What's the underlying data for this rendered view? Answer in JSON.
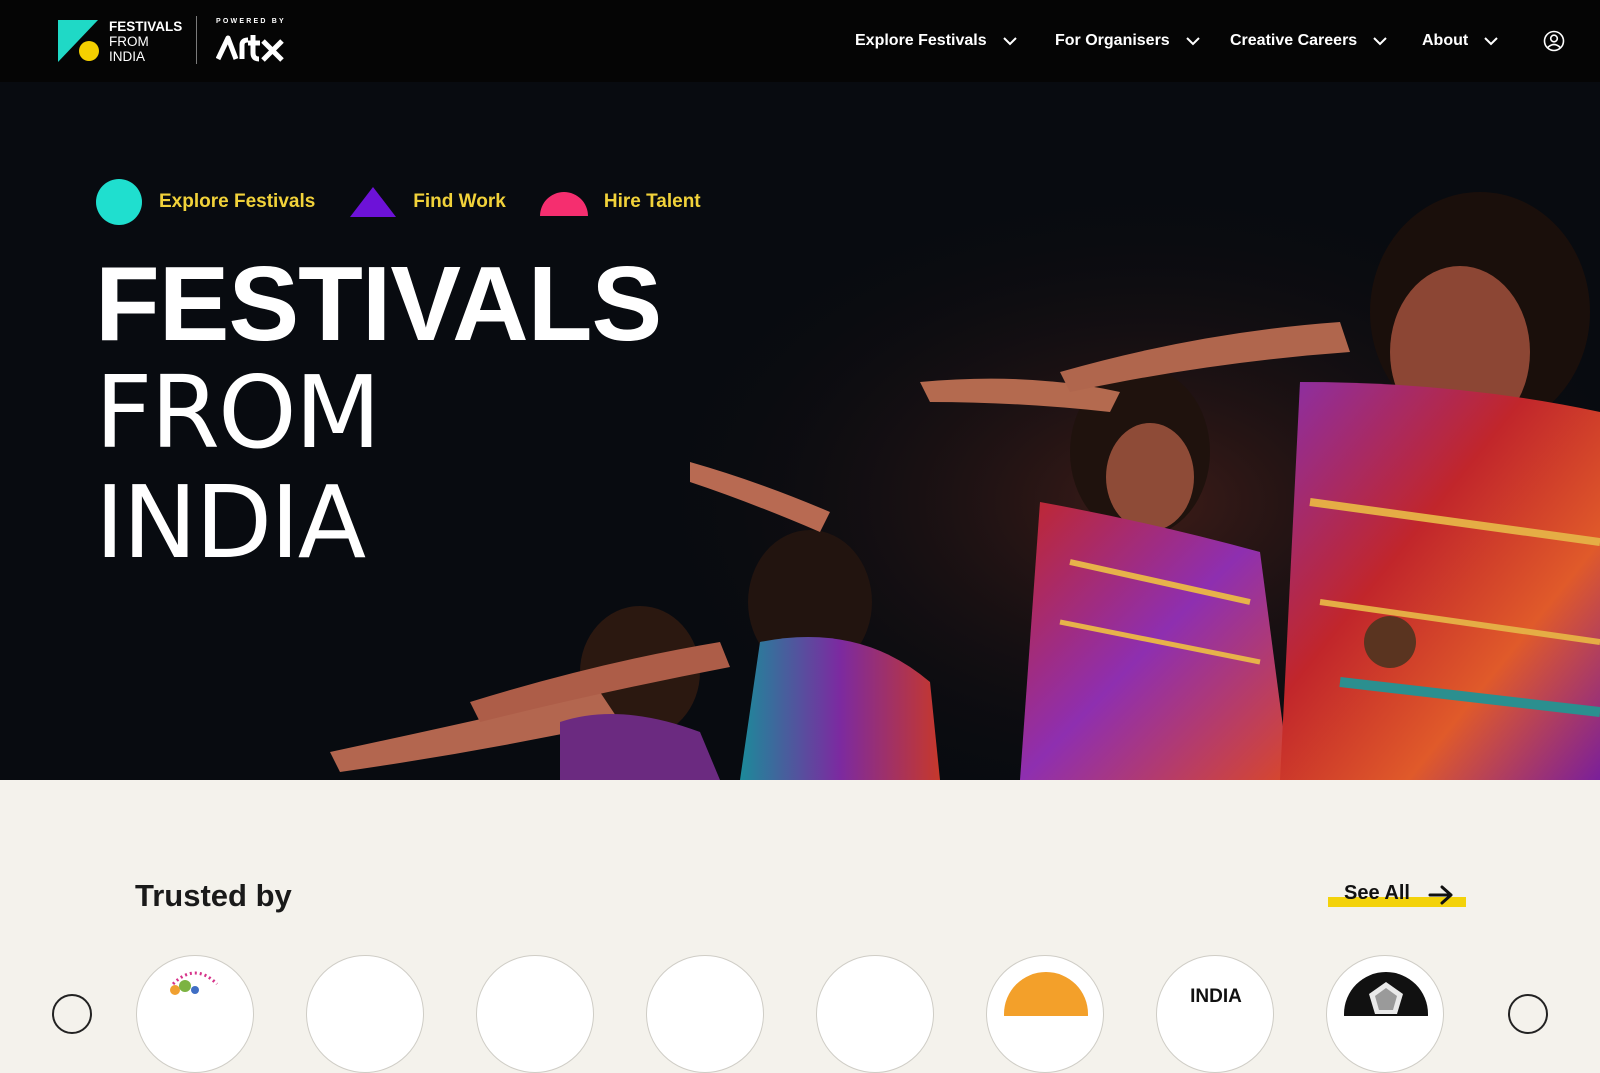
{
  "header": {
    "logo": {
      "line1": "FESTIVALS",
      "line2": "FROM",
      "line3": "INDIA",
      "powered_by": "POWERED BY",
      "partner": "artx"
    },
    "nav": [
      {
        "label": "Explore Festivals"
      },
      {
        "label": "For Organisers"
      },
      {
        "label": "Creative Careers"
      },
      {
        "label": "About"
      }
    ],
    "user_icon": "user-circle-icon"
  },
  "hero": {
    "quick_links": [
      {
        "label": "Explore Festivals",
        "icon": "circle",
        "color": "#1fdfcf"
      },
      {
        "label": "Find Work",
        "icon": "triangle",
        "color": "#6d12d8"
      },
      {
        "label": "Hire Talent",
        "icon": "semicircle",
        "color": "#f52e6f"
      }
    ],
    "title_line1": "FESTIVALS",
    "title_line2": "FROM",
    "title_line3": "INDIA",
    "accent_text_color": "#f1d23a"
  },
  "trusted": {
    "title": "Trusted by",
    "see_all": "See All",
    "partner_partial_text": "INDIA"
  }
}
